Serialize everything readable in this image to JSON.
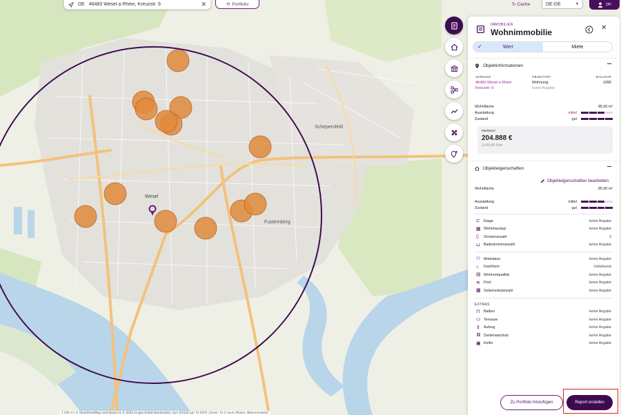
{
  "topbar": {
    "search_country": "DE",
    "search_address": "46483 Wesel a Rhein, Kreuzstr. 9",
    "portfolio_label": "Portfolio",
    "cache_label": "Cache",
    "locale_value": "DE-DE",
    "avatar_initials": "DH"
  },
  "map": {
    "labels": {
      "city": "Wesel",
      "district_1": "Schepersfeld",
      "district_2": "Fusternberg"
    },
    "attribution": "1 200 m | © OpenStreetMap contributors & © 2024 on-geo GmbH Koordinaten: Lon: 6.6133 Lat: 51.6476 | Zoom: 15.1 Land | Modus: Wohnimmobilie",
    "colors": {
      "comparables": "#e08a3c",
      "radius": "#3e0a50",
      "pin": "#6a1b7a",
      "water": "#b9d5ea",
      "green": "#cfe3b0",
      "road": "#f2c27b"
    }
  },
  "panel": {
    "kicker": "IMMOBILIEN",
    "title": "Wohnimmobilie",
    "tab_value": "Wert",
    "tab_rent": "Miete",
    "object_info": {
      "heading": "Objektinformationen",
      "address_label": "ADRESSE",
      "address_line1": "46483 Wesel a Rhein",
      "address_line2": "Kreuzstr. 9",
      "type_label": "OBJEKTART",
      "type_value": "Wohnung",
      "type_sub": "keine Angabe",
      "year_label": "BAUJAHR",
      "year_value": "1990",
      "living_area_label": "Wohnfläche",
      "living_area_value": "85,00 m²",
      "equipment_label": "Ausstattung",
      "equipment_value": "mittel",
      "equipment_level": 3,
      "condition_label": "Zustand",
      "condition_value": "gut",
      "condition_level": 4,
      "market_label": "Marktwert",
      "market_value": "204.888 €",
      "market_sqm": "2.410,45 €/m²"
    },
    "properties": {
      "heading": "Objekteigenschaften",
      "edit_label": "Objekteigenschaften bearbeiten",
      "living_area_label": "Wohnfläche",
      "living_area_value": "85,00 m²",
      "equipment_label": "Ausstattung",
      "equipment_value": "mittel",
      "condition_label": "Zustand",
      "condition_value": "gut",
      "group1": [
        {
          "label": "Etage",
          "value": "keine Angabe",
          "icon": "stairs-icon"
        },
        {
          "label": "Wohnhaustyp",
          "value": "keine Angabe",
          "icon": "building-icon"
        },
        {
          "label": "Zimmeranzahl",
          "value": "3",
          "icon": "door-icon"
        },
        {
          "label": "Badezimmeranzahl",
          "value": "keine Angabe",
          "icon": "bath-icon"
        }
      ],
      "group2": [
        {
          "label": "Mietstatus",
          "value": "keine Angabe",
          "icon": "people-icon"
        },
        {
          "label": "Dachform",
          "value": "Unbekannt",
          "icon": "roof-icon"
        },
        {
          "label": "Wohnortqualität",
          "value": "keine Angabe",
          "icon": "map-quality-icon"
        },
        {
          "label": "Pool",
          "value": "keine Angabe",
          "icon": "pool-icon"
        },
        {
          "label": "Solarmodulanzahl",
          "value": "keine Angabe",
          "icon": "solar-icon"
        }
      ],
      "extras_label": "EXTRAS",
      "extras": [
        {
          "label": "Balkon",
          "value": "keine Angabe",
          "icon": "balcony-icon"
        },
        {
          "label": "Terrasse",
          "value": "keine Angabe",
          "icon": "terrace-icon"
        },
        {
          "label": "Aufzug",
          "value": "keine Angabe",
          "icon": "elevator-icon"
        },
        {
          "label": "Denkmalschutz",
          "value": "keine Angabe",
          "icon": "monument-icon"
        },
        {
          "label": "Keller",
          "value": "keine Angabe",
          "icon": "cellar-icon"
        }
      ]
    },
    "footer": {
      "add_portfolio_label": "Zu Portfolio hinzufügen",
      "report_label": "Report erstellen"
    }
  }
}
